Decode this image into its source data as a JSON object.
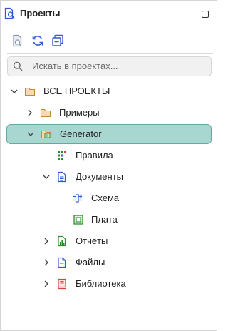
{
  "panel": {
    "title": "Проекты"
  },
  "search": {
    "placeholder": "Искать в проектах..."
  },
  "tree": {
    "root": {
      "label": "ВСЕ ПРОЕКТЫ"
    },
    "examples": {
      "label": "Примеры"
    },
    "generator": {
      "label": "Generator"
    },
    "rules": {
      "label": "Правила"
    },
    "documents": {
      "label": "Документы"
    },
    "schema": {
      "label": "Схема"
    },
    "board": {
      "label": "Плата"
    },
    "reports": {
      "label": "Отчёты"
    },
    "files": {
      "label": "Файлы"
    },
    "library": {
      "label": "Библиотека"
    }
  },
  "colors": {
    "selection": "#a8d6d1",
    "selection_border": "#67a9a2",
    "folder": "#e8c48a",
    "accent_blue": "#2f5bd6",
    "accent_green": "#2e8b2e",
    "accent_red": "#d9443f"
  },
  "icons": {
    "title": "projects-search-icon",
    "maximize": "maximize-icon",
    "toolbar": [
      "open-project-icon",
      "refresh-icon",
      "collapse-all-icon"
    ]
  }
}
